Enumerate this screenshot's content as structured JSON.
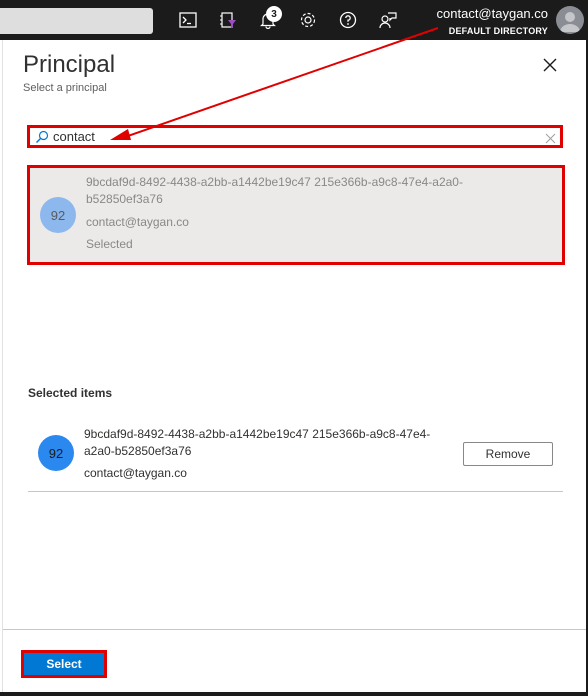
{
  "topbar": {
    "notifications_count": "3",
    "account_email": "contact@taygan.co",
    "account_directory": "DEFAULT DIRECTORY",
    "icons": [
      "cloud-shell-icon",
      "directory-filter-icon",
      "notifications-icon",
      "settings-icon",
      "help-icon",
      "feedback-icon"
    ]
  },
  "panel": {
    "title": "Principal",
    "subtitle": "Select a principal",
    "search": {
      "value": "contact",
      "placeholder": ""
    },
    "results": [
      {
        "initials": "92",
        "id": "9bcdaf9d-8492-4438-a2bb-a1442be19c47 215e366b-a9c8-47e4-a2a0-b52850ef3a76",
        "email": "contact@taygan.co",
        "status": "Selected"
      }
    ],
    "selected_heading": "Selected items",
    "selected_items": [
      {
        "initials": "92",
        "id": "9bcdaf9d-8492-4438-a2bb-a1442be19c47 215e366b-a9c8-47e4-a2a0-b52850ef3a76",
        "email": "contact@taygan.co",
        "remove_label": "Remove"
      }
    ],
    "select_label": "Select"
  },
  "colors": {
    "topbar_bg": "#1b1b1b",
    "annotation_red": "#e00000",
    "primary_blue": "#0078d4",
    "avatar_selected": "#2b88ee",
    "avatar_result": "#8db8ee",
    "result_bg": "#eceae8"
  }
}
